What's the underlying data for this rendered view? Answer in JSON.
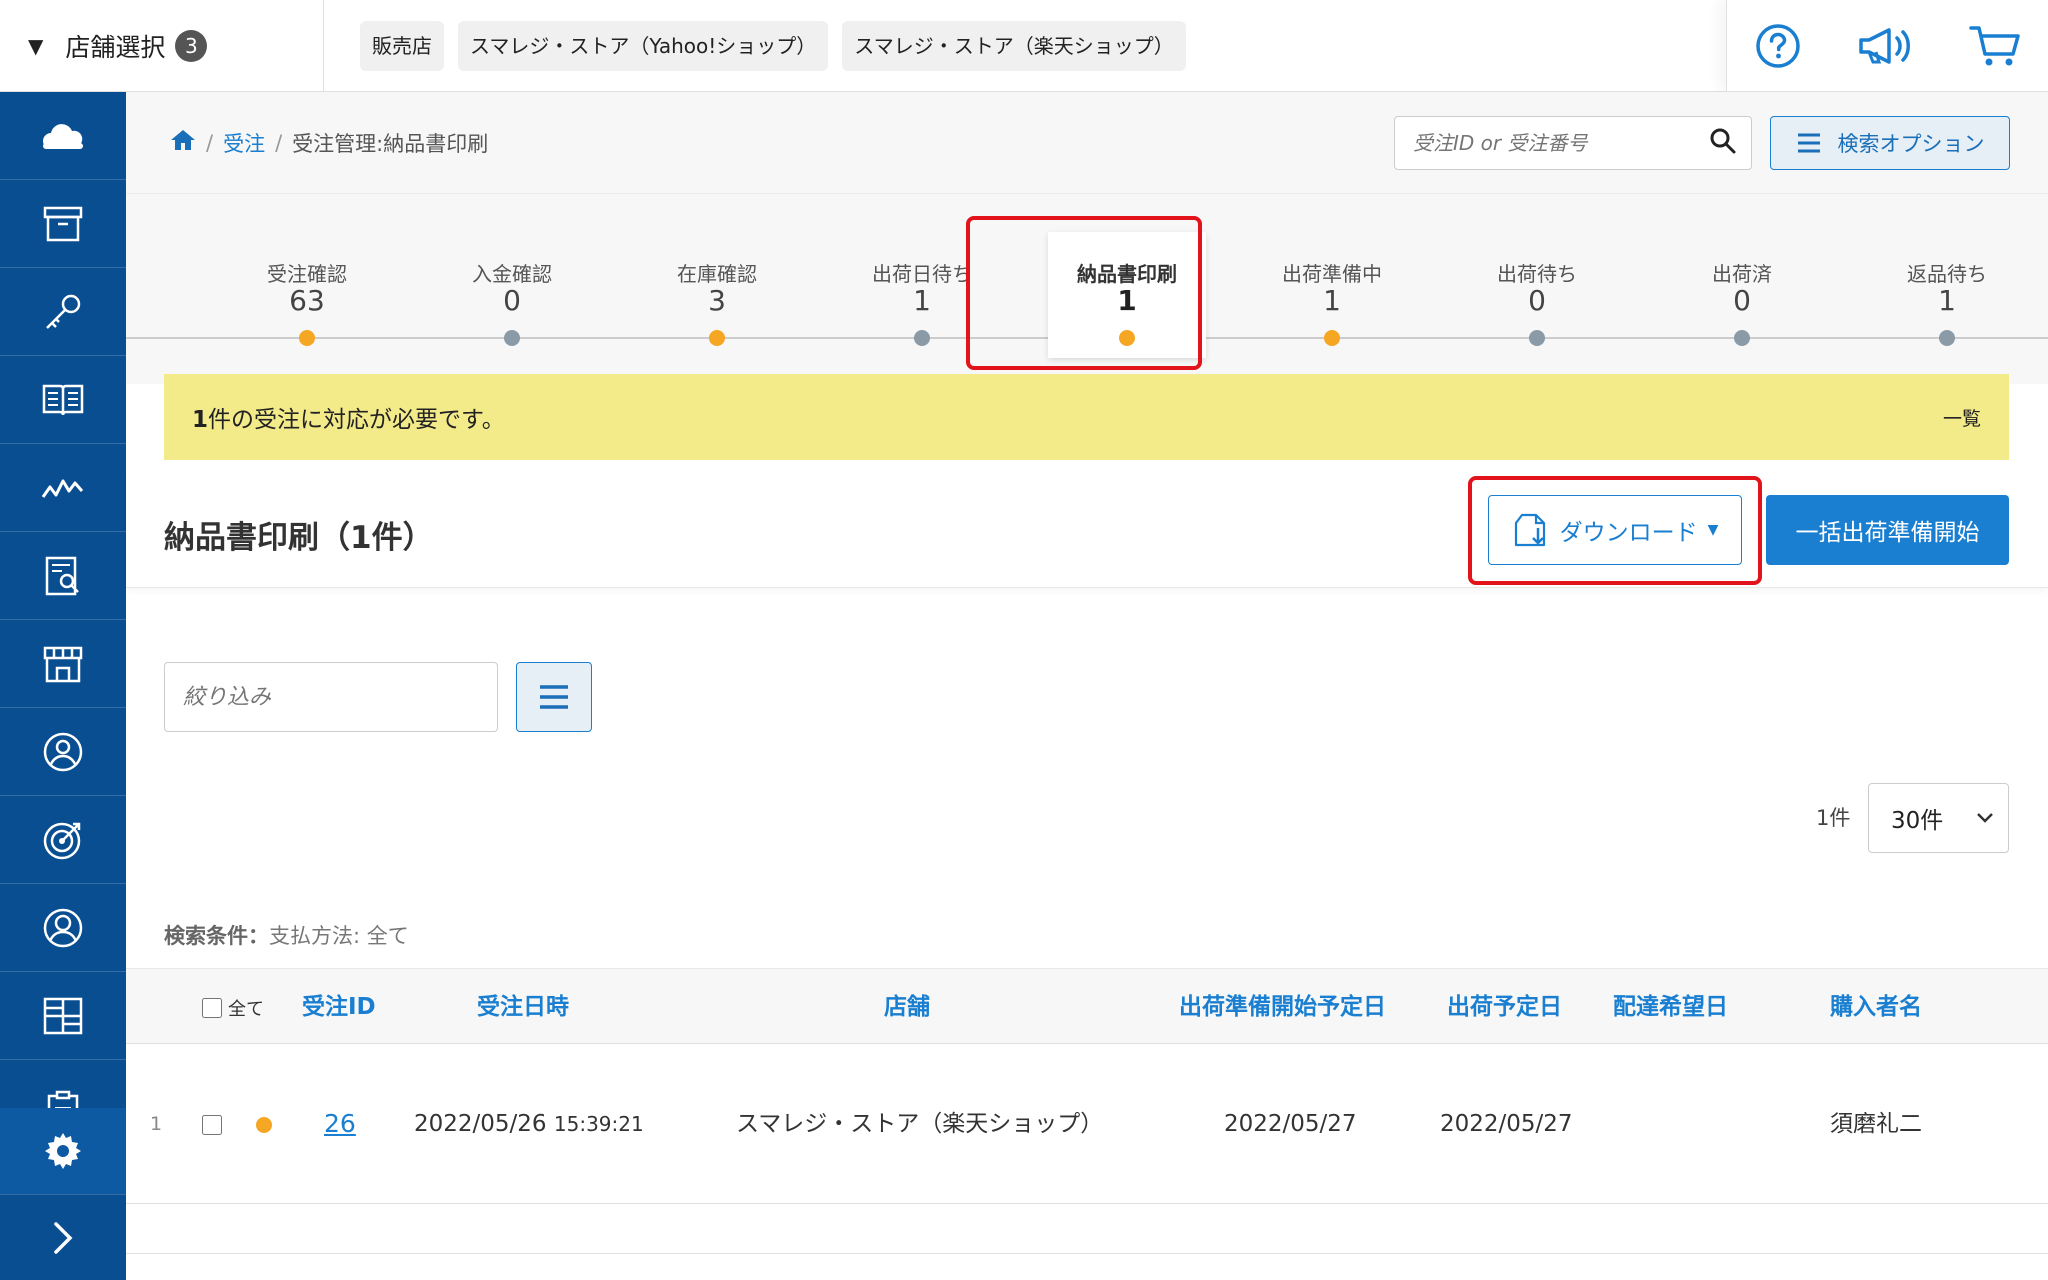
{
  "topbar": {
    "store_select_label": "店舗選択",
    "store_select_count": "3",
    "chips": [
      "販売店",
      "スマレジ・ストア（Yahoo!ショップ）",
      "スマレジ・ストア（楽天ショップ）"
    ]
  },
  "sidebar": {
    "items": [
      "cloud-icon",
      "archive-icon",
      "key-icon",
      "book-icon",
      "chart-icon",
      "report-icon",
      "store-icon",
      "customer-icon",
      "target-icon",
      "user-icon",
      "grid-icon",
      "clipboard-icon"
    ],
    "bottom": [
      "gear-icon",
      "chevron-right-icon"
    ]
  },
  "breadcrumb": {
    "orders_link": "受注",
    "current": "受注管理:納品書印刷"
  },
  "search": {
    "placeholder": "受注ID or 受注番号",
    "option_label": "検索オプション"
  },
  "tabs": [
    {
      "label": "受注確認",
      "count": "63",
      "dot": "orange"
    },
    {
      "label": "入金確認",
      "count": "0",
      "dot": "gray"
    },
    {
      "label": "在庫確認",
      "count": "3",
      "dot": "orange"
    },
    {
      "label": "出荷日待ち",
      "count": "1",
      "dot": "gray"
    },
    {
      "label": "納品書印刷",
      "count": "1",
      "dot": "orange",
      "active": true
    },
    {
      "label": "出荷準備中",
      "count": "1",
      "dot": "orange"
    },
    {
      "label": "出荷待ち",
      "count": "0",
      "dot": "gray"
    },
    {
      "label": "出荷済",
      "count": "0",
      "dot": "gray"
    },
    {
      "label": "返品待ち",
      "count": "1",
      "dot": "gray"
    }
  ],
  "notice": {
    "count": "1",
    "message": "件の受注に対応が必要です。",
    "list_link": "一覧"
  },
  "page": {
    "title": "納品書印刷（1件）",
    "download_label": "ダウンロード",
    "bulk_label": "一括出荷準備開始",
    "filter_placeholder": "絞り込み",
    "result_count": "1件",
    "per_page": "30件",
    "search_cond_label": "検索条件：",
    "search_cond_value": "支払方法: 全て"
  },
  "table": {
    "select_all_label": "全て",
    "headers": {
      "order_id": "受注ID",
      "order_date": "受注日時",
      "store": "店舗",
      "prep_date": "出荷準備開始予定日",
      "ship_date": "出荷予定日",
      "delivery_date": "配達希望日",
      "buyer": "購入者名"
    },
    "rows": [
      {
        "num": "1",
        "order_id": "26",
        "order_date": "2022/05/26",
        "order_time": "15:39:21",
        "store": "スマレジ・ストア（楽天ショップ）",
        "prep_date": "2022/05/27",
        "ship_date": "2022/05/27",
        "delivery_date": "",
        "buyer": "須磨礼二"
      }
    ]
  },
  "colors": {
    "sidebar": "#0a4e92",
    "accent": "#1a7fd0",
    "notice": "#f3ea8a",
    "highlight": "#e3131b",
    "status_orange": "#f5a623"
  }
}
